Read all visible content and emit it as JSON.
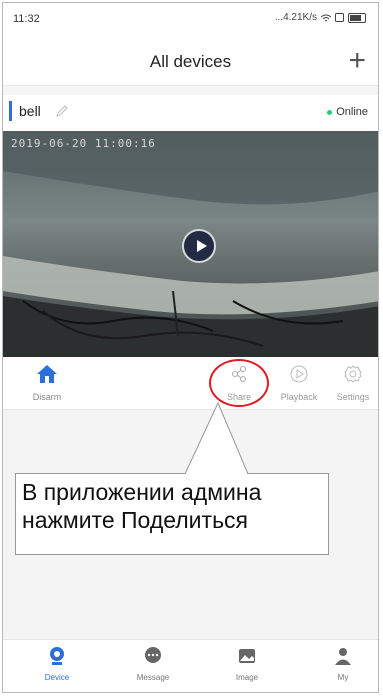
{
  "status_bar": {
    "time": "11:32",
    "right": "...4.21K/s"
  },
  "header": {
    "title": "All devices",
    "add_label": "+"
  },
  "device": {
    "name": "bell",
    "status": "Online"
  },
  "video": {
    "timestamp": "2019-06-20  11:00:16"
  },
  "actions": [
    {
      "label": "Disarm"
    },
    {
      "label": "Share"
    },
    {
      "label": "Playback"
    },
    {
      "label": "Settings"
    }
  ],
  "callout": {
    "text": "В приложении админа нажмите Поделиться"
  },
  "bottom_nav": [
    {
      "label": "Device"
    },
    {
      "label": "Message"
    },
    {
      "label": "Image"
    },
    {
      "label": "My"
    }
  ],
  "colors": {
    "accent": "#2b6fdb",
    "online": "#2ecc71",
    "callout_ring": "#e01b24"
  }
}
